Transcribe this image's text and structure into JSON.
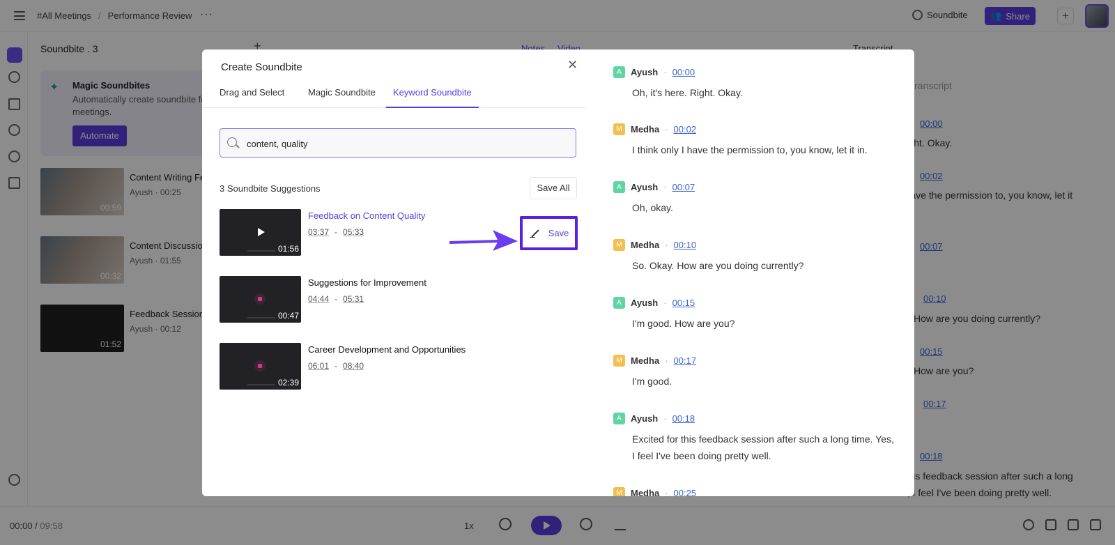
{
  "header": {
    "breadcrumb": [
      "#All Meetings",
      "Performance Review"
    ],
    "soundbite_label": "Soundbite",
    "share_label": "Share"
  },
  "soundbites_panel": {
    "title": "Soundbite . 3",
    "magic": {
      "title": "Magic Soundbites",
      "subtitle": "Automatically create soundbite fr meetings.",
      "button": "Automate"
    },
    "items": [
      {
        "title": "Content Writing Fe",
        "speaker": "Ayush",
        "start": "00:25",
        "duration": "00:59"
      },
      {
        "title": "Content Discussio",
        "speaker": "Ayush",
        "start": "01:55",
        "duration": "00:32"
      },
      {
        "title": "Feedback Session",
        "speaker": "Ayush",
        "start": "00:12",
        "duration": "01:52"
      }
    ]
  },
  "center_tabs": [
    "Notes",
    "Video"
  ],
  "transcript_bg": {
    "title": "Transcript",
    "search_placeholder": "Search transcript",
    "lines": [
      {
        "time": "00:00",
        "text": "re. Right. Okay."
      },
      {
        "time": "00:02",
        "text": "y I have the permission to, you know, let it"
      },
      {
        "time": "00:07",
        "text": ""
      },
      {
        "time": "00:10",
        "text": "How are you doing currently?"
      },
      {
        "time": "00:15",
        "text": "How are you?"
      },
      {
        "time": "00:17",
        "text": ""
      },
      {
        "time": "00:18",
        "text": "r this feedback session after such a long"
      },
      {
        "time": "",
        "text": "time. Yes, I feel I've been doing pretty well."
      }
    ]
  },
  "player": {
    "current": "00:00",
    "total": "09:58",
    "speed": "1x"
  },
  "modal": {
    "title": "Create Soundbite",
    "tabs": [
      "Drag and Select",
      "Magic Soundbite",
      "Keyword Soundbite"
    ],
    "active_tab": "Keyword Soundbite",
    "search_value": "content, quality",
    "suggestions_count": "3 Soundbite Suggestions",
    "save_all": "Save All",
    "save": "Save",
    "suggestions": [
      {
        "title": "Feedback on Content Quality",
        "start": "03:37",
        "end": "05:33",
        "duration": "01:56"
      },
      {
        "title": "Suggestions for Improvement",
        "start": "04:44",
        "end": "05:31",
        "duration": "00:47"
      },
      {
        "title": "Career Development and Opportunities",
        "start": "06:01",
        "end": "08:40",
        "duration": "02:39"
      }
    ],
    "transcript": [
      {
        "initial": "A",
        "speaker": "Ayush",
        "time": "00:00",
        "text": "Oh, it's here. Right. Okay."
      },
      {
        "initial": "M",
        "speaker": "Medha",
        "time": "00:02",
        "text": "I think only I have the permission to, you know, let it in."
      },
      {
        "initial": "A",
        "speaker": "Ayush",
        "time": "00:07",
        "text": "Oh, okay."
      },
      {
        "initial": "M",
        "speaker": "Medha",
        "time": "00:10",
        "text": "So. Okay. How are you doing currently?"
      },
      {
        "initial": "A",
        "speaker": "Ayush",
        "time": "00:15",
        "text": "I'm good. How are you?"
      },
      {
        "initial": "M",
        "speaker": "Medha",
        "time": "00:17",
        "text": "I'm good."
      },
      {
        "initial": "A",
        "speaker": "Ayush",
        "time": "00:18",
        "text": "Excited for this feedback session after such a long time. Yes, I feel I've been doing pretty well."
      },
      {
        "initial": "M",
        "speaker": "Medha",
        "time": "00:25",
        "text": ""
      }
    ]
  },
  "colors": {
    "accent": "#5b3ce0",
    "ayush": "#5fd4a4",
    "medha": "#f4bf4f",
    "link": "#3a62d8"
  }
}
